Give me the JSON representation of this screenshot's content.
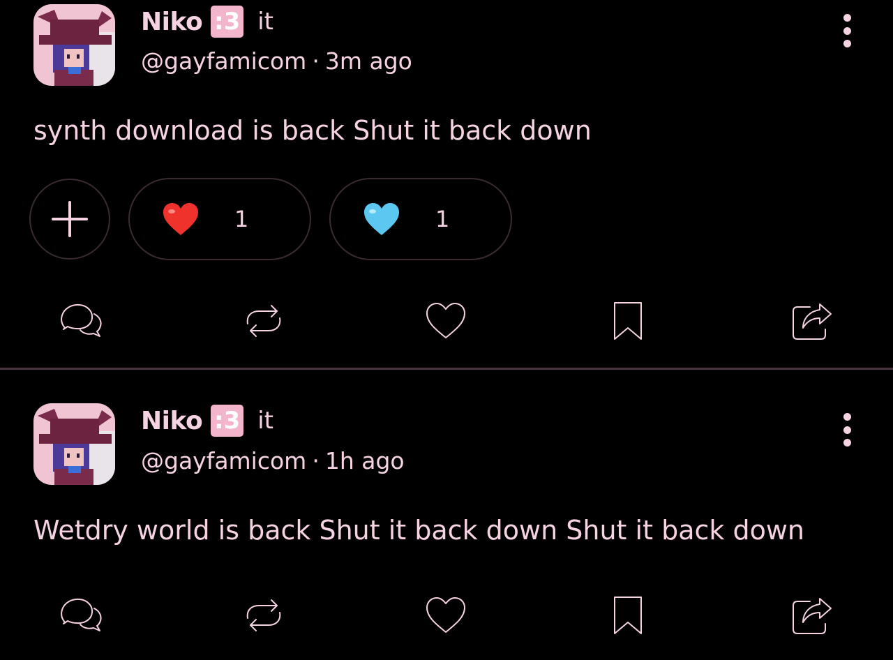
{
  "posts": [
    {
      "author": {
        "name": "Niko",
        "emoji_badge": ":3",
        "flag": "it",
        "handle": "@gayfamicom",
        "time": "3m ago"
      },
      "text": "synth download is back Shut it back down",
      "reactions": [
        {
          "emoji": "red-heart-icon",
          "count": "1"
        },
        {
          "emoji": "light-blue-heart-icon",
          "count": "1"
        }
      ]
    },
    {
      "author": {
        "name": "Niko",
        "emoji_badge": ":3",
        "flag": "it",
        "handle": "@gayfamicom",
        "time": "1h ago"
      },
      "text": "Wetdry world is back Shut it back down Shut it back down"
    }
  ],
  "separator": "·",
  "colors": {
    "background": "#000000",
    "text": "#f6d3e3",
    "divider": "#4a3340",
    "badge": "#f3b5cc"
  }
}
